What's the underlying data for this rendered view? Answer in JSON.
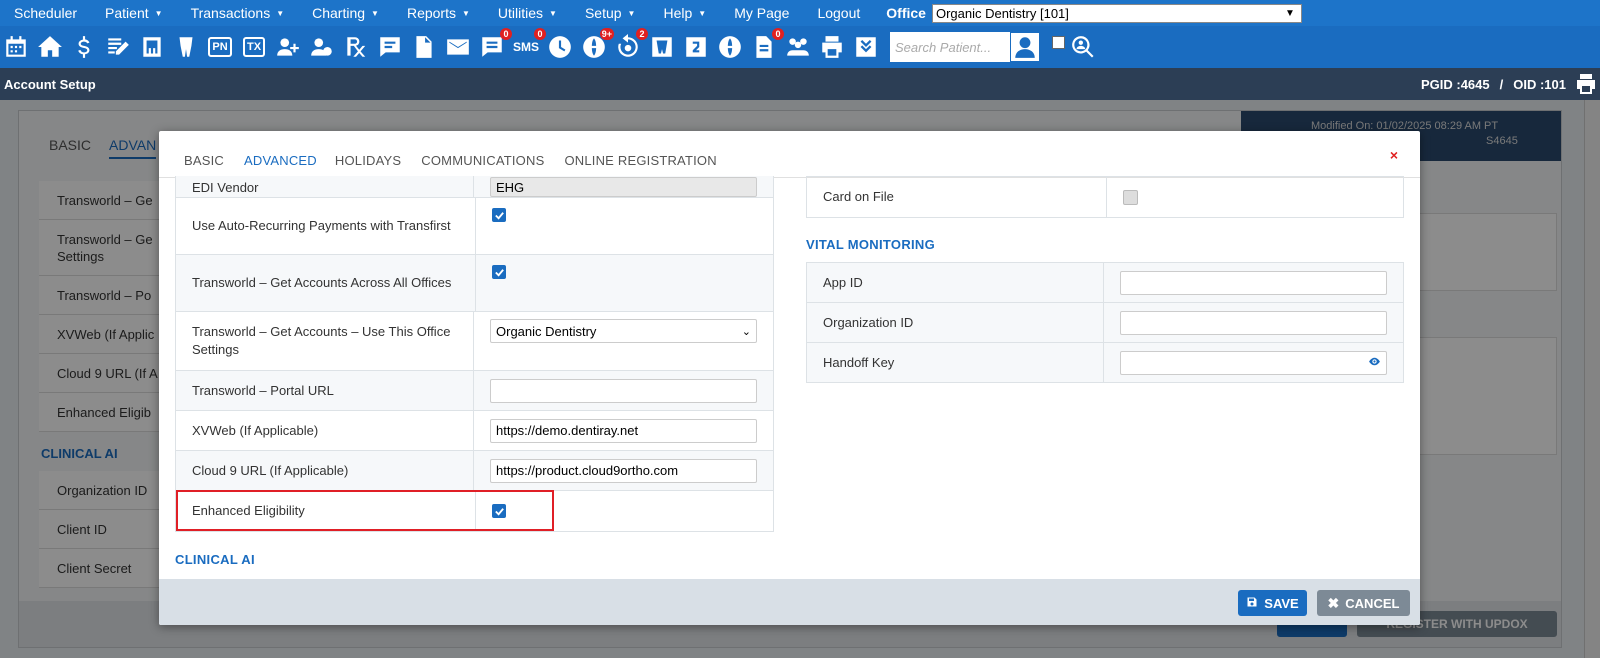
{
  "menu": {
    "items": [
      "Scheduler",
      "Patient",
      "Transactions",
      "Charting",
      "Reports",
      "Utilities",
      "Setup",
      "Help",
      "My Page",
      "Logout"
    ],
    "office_label": "Office",
    "office_value": "Organic Dentistry [101]"
  },
  "toolbar": {
    "search_placeholder": "Search Patient...",
    "badges": {
      "messages": "0",
      "sms": "0",
      "globe": "9+",
      "recall": "2",
      "sms2": "0"
    },
    "pn": "PN",
    "tx": "TX",
    "sms": "SMS"
  },
  "header": {
    "title": "Account Setup",
    "pgid": "PGID :4645",
    "separator": "/",
    "oid": "OID :101"
  },
  "background": {
    "tabs": [
      "BASIC",
      "ADVAN"
    ],
    "modified": "Modified On: 01/02/2025 08:29 AM PT",
    "modified2": "S4645",
    "rows": [
      "Transworld – Ge",
      "Transworld – Ge Settings",
      "Transworld – Po",
      "XVWeb (If Applic",
      "Cloud 9 URL (If A",
      "Enhanced Eligib"
    ],
    "clinical_ai": "CLINICAL AI",
    "ai_rows": [
      "Organization ID",
      "Client ID",
      "Client Secret"
    ],
    "register_btn": "REGISTER WITH UPDOX"
  },
  "modal": {
    "tabs": [
      "BASIC",
      "ADVANCED",
      "HOLIDAYS",
      "COMMUNICATIONS",
      "ONLINE REGISTRATION"
    ],
    "close": "×",
    "left_rows": {
      "edi_vendor": {
        "label": "EDI Vendor",
        "value": "EHG"
      },
      "auto_recurring": {
        "label": "Use Auto-Recurring Payments with Transfirst"
      },
      "tw_all_offices": {
        "label": "Transworld – Get Accounts Across All Offices"
      },
      "tw_this_office": {
        "label": "Transworld – Get Accounts – Use This Office Settings",
        "value": "Organic Dentistry"
      },
      "tw_portal": {
        "label": "Transworld – Portal URL",
        "value": ""
      },
      "xvweb": {
        "label": "XVWeb (If Applicable)",
        "value": "https://demo.dentiray.net"
      },
      "cloud9": {
        "label": "Cloud 9 URL (If Applicable)",
        "value": "https://product.cloud9ortho.com"
      },
      "enhanced": {
        "label": "Enhanced Eligibility"
      }
    },
    "clinical_ai": "CLINICAL AI",
    "card_on_file": "Card on File",
    "vital_monitoring": "VITAL MONITORING",
    "vital_rows": {
      "app_id": {
        "label": "App ID",
        "value": ""
      },
      "org_id": {
        "label": "Organization ID",
        "value": ""
      },
      "handoff": {
        "label": "Handoff Key",
        "value": ""
      }
    },
    "save": "SAVE",
    "cancel": "CANCEL"
  }
}
